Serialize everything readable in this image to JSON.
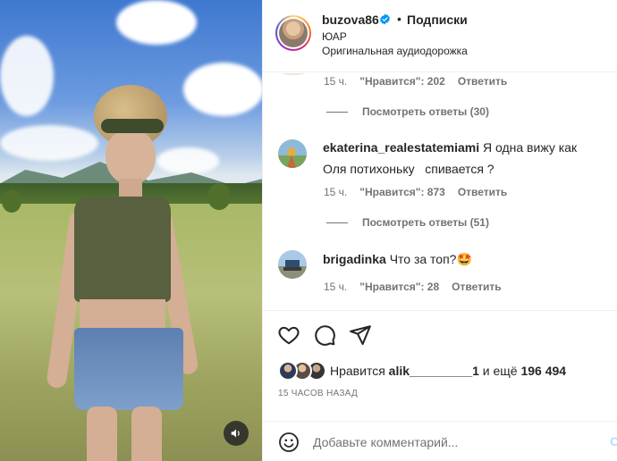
{
  "post": {
    "username": "buzova86",
    "separator": "•",
    "follow_label": "Подписки",
    "location": "ЮАР",
    "audio": "Оригинальная аудиодорожка"
  },
  "comments": [
    {
      "time": "15 ч.",
      "likes_label": "\"Нравится\": 202",
      "reply_label": "Ответить",
      "view_replies": "Посмотреть ответы (30)"
    },
    {
      "username": "ekaterina_realestatemiami",
      "text_line1": "Я одна вижу как",
      "text_line2": "Оля потихоньку   спивается ?",
      "time": "15 ч.",
      "likes_label": "\"Нравится\": 873",
      "reply_label": "Ответить",
      "view_replies": "Посмотреть ответы (51)"
    },
    {
      "username": "brigadinka",
      "text": "Что за топ?🤩",
      "time": "15 ч.",
      "likes_label": "\"Нравится\": 28",
      "reply_label": "Ответить"
    }
  ],
  "actions": {
    "like_icon": "heart-icon",
    "comment_icon": "comment-icon",
    "share_icon": "send-icon"
  },
  "likes": {
    "prefix": "Нравится",
    "user": "alik_________1",
    "middle": "и ещё",
    "count": "196 494"
  },
  "time_ago": "15 ЧАСОВ НАЗАД",
  "add_comment": {
    "placeholder": "Добавьте комментарий...",
    "post_label": "О"
  },
  "colors": {
    "verified": "#0095f6",
    "muted": "#737373",
    "text": "#262626",
    "divider": "#efefef"
  }
}
